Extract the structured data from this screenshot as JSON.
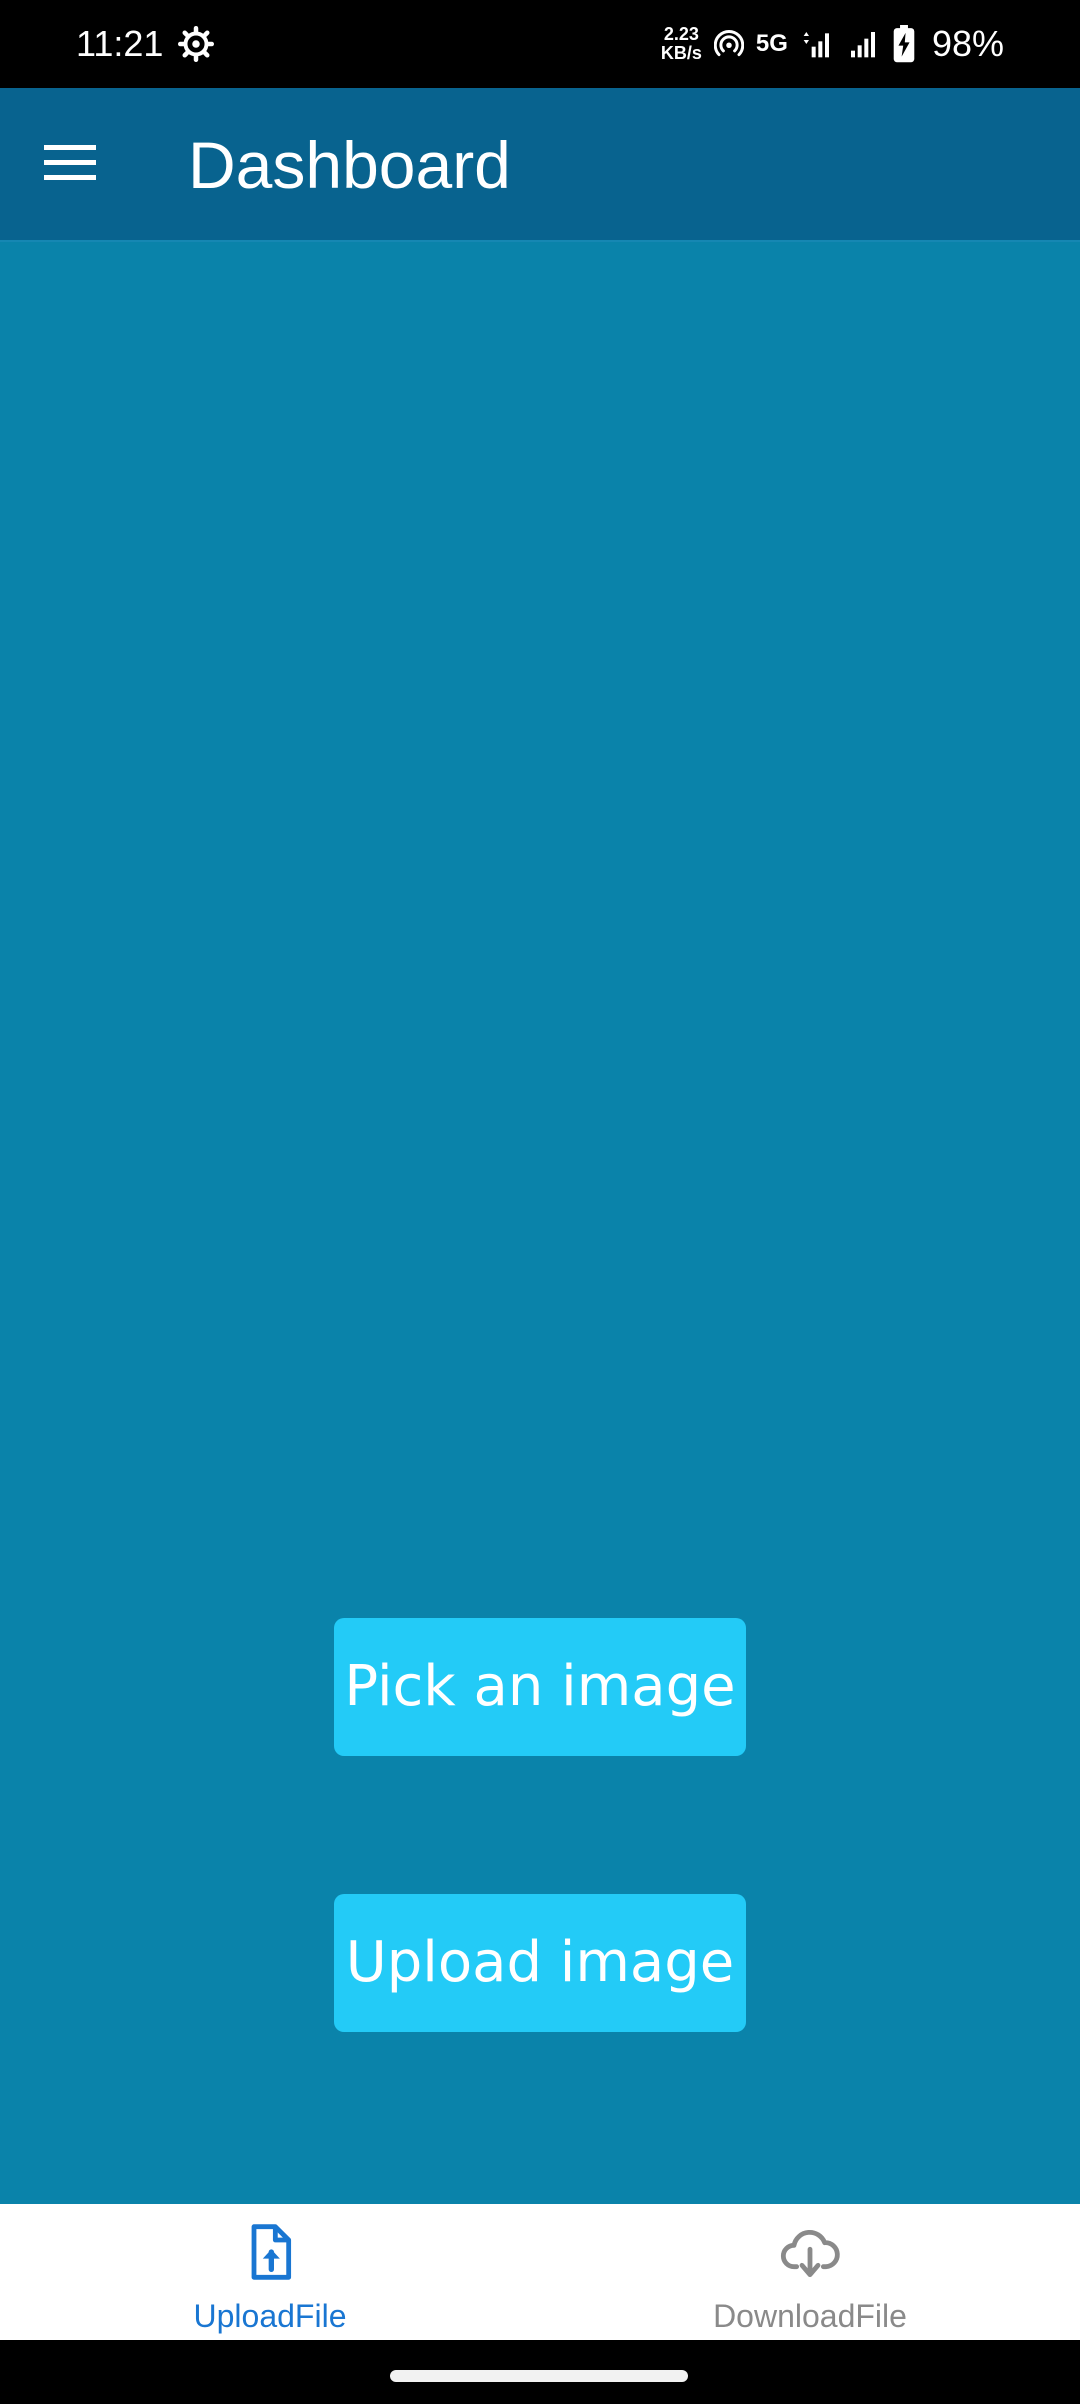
{
  "status_bar": {
    "time": "11:21",
    "net_speed_value": "2.23",
    "net_speed_unit": "KB/s",
    "network_type": "5G",
    "battery_percent": "98%",
    "icons": [
      "gear-icon",
      "hotspot-icon",
      "signal-icon",
      "signal-icon",
      "battery-charging-icon"
    ]
  },
  "app_bar": {
    "title": "Dashboard",
    "menu_icon": "menu-icon"
  },
  "main": {
    "pick_button_label": "Pick an image",
    "upload_button_label": "Upload image"
  },
  "bottom_nav": {
    "items": [
      {
        "label": "UploadFile",
        "icon": "file-upload-icon",
        "active": true
      },
      {
        "label": "DownloadFile",
        "icon": "cloud-download-icon",
        "active": false
      }
    ]
  },
  "colors": {
    "app_bar": "#08638f",
    "background": "#0a83aa",
    "button": "#23cbf7",
    "active_nav": "#1976d2",
    "inactive_nav": "#8a8a8a"
  }
}
